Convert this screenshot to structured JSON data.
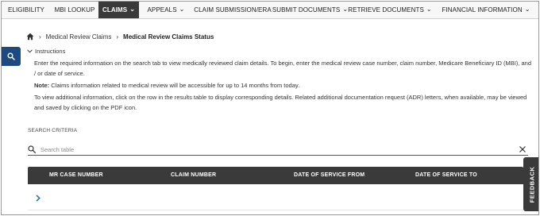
{
  "nav": {
    "items": [
      {
        "label": "ELIGIBILITY"
      },
      {
        "label": "MBI LOOKUP"
      },
      {
        "label": "CLAIMS"
      },
      {
        "label": "APPEALS"
      },
      {
        "label": "CLAIM SUBMISSION/ERA"
      },
      {
        "label": "SUBMIT DOCUMENTS"
      },
      {
        "label": "RETRIEVE DOCUMENTS"
      },
      {
        "label": "FINANCIAL INFORMATION"
      }
    ],
    "active": "CLAIMS"
  },
  "breadcrumb": {
    "parent": "Medical Review Claims",
    "current": "Medical Review Claims Status"
  },
  "instructions": {
    "toggle_label": "Instructions",
    "line1": "Enter the required information on the search tab to view medically reviewed claim details. To begin, enter the medical review case number, claim number, Medicare Beneficiary ID (MBI), and / or date of service.",
    "note_label": "Note:",
    "note_text": " Claims information related to medical review will be accessible for up to 14 months from today.",
    "line3": "To view additional information, click on the row in the results table to display corresponding details. Related additional documentation request (ADR) letters, when available, may be viewed and saved by clicking on the PDF icon."
  },
  "search_criteria": {
    "label": "SEARCH CRITERIA",
    "placeholder": "Search table"
  },
  "table": {
    "columns": [
      "MR CASE NUMBER",
      "CLAIM NUMBER",
      "DATE OF SERVICE FROM",
      "DATE OF SERVICE TO"
    ]
  },
  "feedback": {
    "label": "FEEDBACK"
  },
  "colors": {
    "accent_blue": "#1d4a80",
    "dark_header": "#3a3a3a",
    "chevron_blue": "#2a7ab8"
  },
  "icons": {
    "home": "home-icon",
    "side_search": "search-icon",
    "search": "search-icon",
    "clear": "close-icon",
    "row_expand": "chevron-right-icon"
  }
}
